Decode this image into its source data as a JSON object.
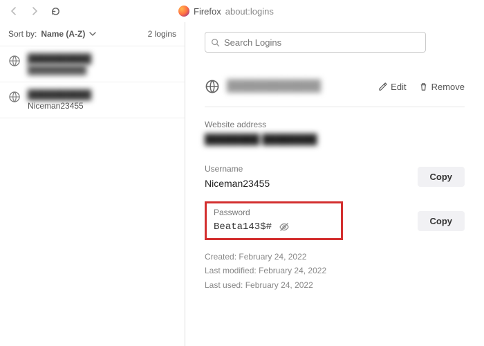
{
  "toolbar": {
    "browser_label": "Firefox",
    "url": "about:logins"
  },
  "sidebar": {
    "sort_label": "Sort by:",
    "sort_value": "Name (A-Z)",
    "count_text": "2 logins",
    "items": [
      {
        "title_masked": "██████████",
        "subtitle_masked": "██████████"
      },
      {
        "title_masked": "██████████",
        "subtitle": "Niceman23455"
      }
    ]
  },
  "search": {
    "placeholder": "Search Logins"
  },
  "detail": {
    "site_masked": "████████████",
    "edit_label": "Edit",
    "remove_label": "Remove",
    "addr_label": "Website address",
    "addr_masked": "████████  ████████",
    "user_label": "Username",
    "user_value": "Niceman23455",
    "pw_label": "Password",
    "pw_value": "Beata143$#",
    "copy_label": "Copy",
    "meta": {
      "created_label": "Created:",
      "created_value": "February 24, 2022",
      "modified_label": "Last modified:",
      "modified_value": "February 24, 2022",
      "used_label": "Last used:",
      "used_value": "February 24, 2022"
    }
  }
}
